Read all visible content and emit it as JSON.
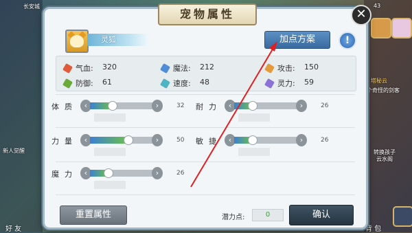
{
  "background": {
    "top_left_text": "长安城",
    "top_right_text": "43",
    "right_text_1": "塔秘云",
    "right_text_2": "个奇怪的剑客",
    "left_text_1": "新人觉醒",
    "right_text_3": "转换孩子",
    "right_text_4": "云水阁",
    "bottom_left_text": "好 友",
    "bottom_right_text": "背 包"
  },
  "panel": {
    "title": "宠物属性",
    "close_label": "✕",
    "pet_name": "灵狐",
    "plan_button": "加点方案",
    "help_label": "!"
  },
  "stats": [
    {
      "label": "气血:",
      "value": "320",
      "icon": "hp-icon",
      "color": "#e05a3c"
    },
    {
      "label": "魔法:",
      "value": "212",
      "icon": "mp-icon",
      "color": "#4f8ed6"
    },
    {
      "label": "攻击:",
      "value": "150",
      "icon": "attack-icon",
      "color": "#e39a3a"
    },
    {
      "label": "防御:",
      "value": "61",
      "icon": "defense-icon",
      "color": "#6aaa3a"
    },
    {
      "label": "速度:",
      "value": "48",
      "icon": "speed-icon",
      "color": "#4fb3c4"
    },
    {
      "label": "灵力:",
      "value": "59",
      "icon": "spirit-icon",
      "color": "#8a72d6"
    }
  ],
  "attributes": [
    {
      "label": "体质",
      "value": "32",
      "fraction": 0.35
    },
    {
      "label": "耐力",
      "value": "26",
      "fraction": 0.28
    },
    {
      "label": "力量",
      "value": "50",
      "fraction": 0.6
    },
    {
      "label": "敏捷",
      "value": "26",
      "fraction": 0.28
    },
    {
      "label": "魔力",
      "value": "26",
      "fraction": 0.28
    }
  ],
  "footer": {
    "reset_button": "重置属性",
    "potential_label": "潜力点:",
    "potential_value": "0",
    "confirm_button": "确认"
  }
}
